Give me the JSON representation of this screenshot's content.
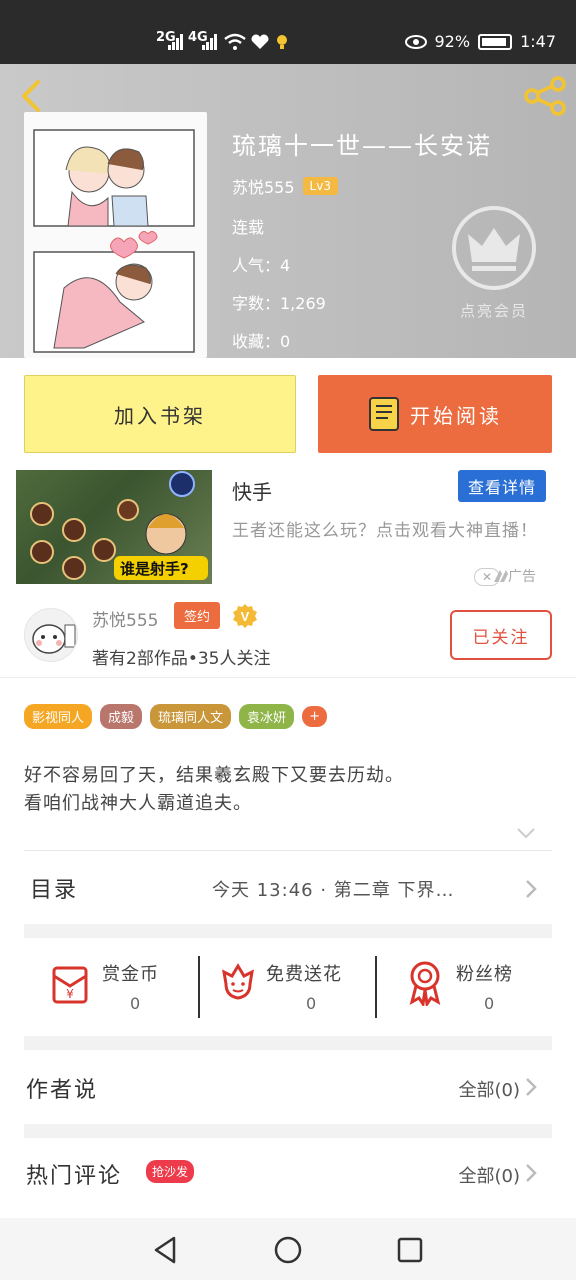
{
  "status_bar": {
    "signal1": "2G",
    "signal2": "4G",
    "battery": "92%",
    "time": "1:47"
  },
  "book": {
    "title": "琉璃十一世——长安诺",
    "author": "苏悦555",
    "level": "Lv3",
    "status": "连载",
    "popularity": "人气：4",
    "word_count": "字数：1,269",
    "favorites": "收藏：0",
    "vip_label": "点亮会员"
  },
  "actions": {
    "add_shelf": "加入书架",
    "start_reading": "开始阅读"
  },
  "ad": {
    "title": "快手",
    "detail_button": "查看详情",
    "description": "王者还能这么玩？点击观看大神直播！",
    "close": "✕",
    "label": "广告",
    "image_caption": "谁是射手?"
  },
  "author_card": {
    "name": "苏悦555",
    "signed": "签约",
    "v_badge": "V",
    "stats": "著有2部作品•35人关注",
    "follow_button": "已关注"
  },
  "tags": [
    {
      "label": "影视同人",
      "color": "#f5a623"
    },
    {
      "label": "成毅",
      "color": "#b9766c"
    },
    {
      "label": "琉璃同人文",
      "color": "#c9963a"
    },
    {
      "label": "袁冰妍",
      "color": "#8fb447"
    },
    {
      "label": "+",
      "color": "#ec6b3f"
    }
  ],
  "description": {
    "line1": "好不容易回了天，结果羲玄殿下又要去历劫。",
    "line2": "看咱们战神大人霸道追夫。"
  },
  "toc": {
    "label": "目录",
    "latest": "今天 13:46 · 第二章 下界…"
  },
  "rewards": {
    "coins": {
      "label": "赏金币",
      "value": "0"
    },
    "flowers": {
      "label": "免费送花",
      "value": "0"
    },
    "fans": {
      "label": "粉丝榜",
      "value": "0"
    }
  },
  "author_says": {
    "label": "作者说",
    "all": "全部(0)"
  },
  "hot_comments": {
    "label": "热门评论",
    "badge": "抢沙发",
    "all": "全部(0)"
  },
  "colors": {
    "accent_orange": "#ec6b3f",
    "shelf_yellow": "#fdf38a",
    "ad_blue": "#2a6fd6",
    "follow_red": "#e0513f"
  }
}
